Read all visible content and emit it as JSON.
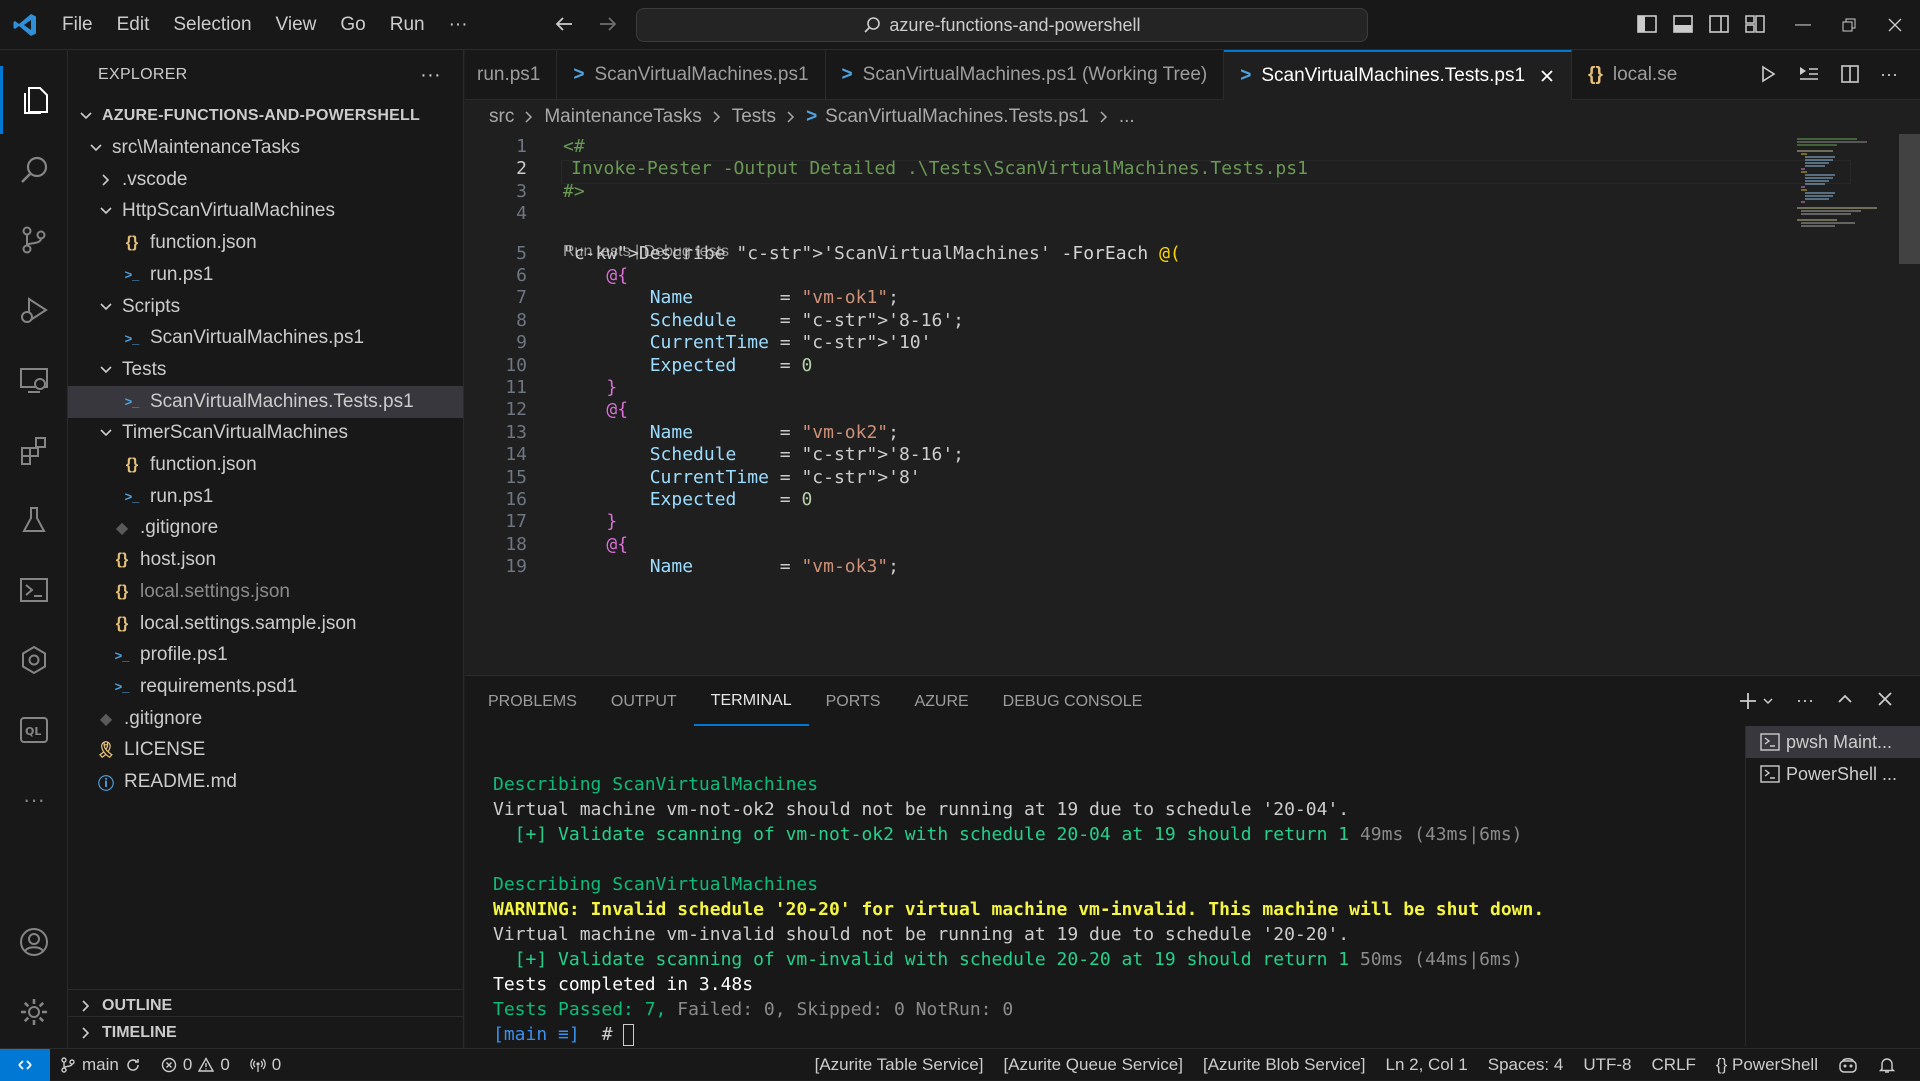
{
  "menu": [
    "File",
    "Edit",
    "Selection",
    "View",
    "Go",
    "Run",
    "···"
  ],
  "command_center": "azure-functions-and-powershell",
  "explorer": {
    "title": "EXPLORER",
    "more": "···",
    "root": "AZURE-FUNCTIONS-AND-POWERSHELL",
    "items": [
      {
        "label": "src\\MaintenanceTasks",
        "kind": "folder-open",
        "depth": 1
      },
      {
        "label": ".vscode",
        "kind": "folder-closed",
        "depth": 2
      },
      {
        "label": "HttpScanVirtualMachines",
        "kind": "folder-open",
        "depth": 2
      },
      {
        "label": "function.json",
        "kind": "json",
        "depth": 3
      },
      {
        "label": "run.ps1",
        "kind": "ps",
        "depth": 3
      },
      {
        "label": "Scripts",
        "kind": "folder-open",
        "depth": 2
      },
      {
        "label": "ScanVirtualMachines.ps1",
        "kind": "ps",
        "depth": 3
      },
      {
        "label": "Tests",
        "kind": "folder-open",
        "depth": 2
      },
      {
        "label": "ScanVirtualMachines.Tests.ps1",
        "kind": "ps",
        "depth": 3,
        "selected": true
      },
      {
        "label": "TimerScanVirtualMachines",
        "kind": "folder-open",
        "depth": 2
      },
      {
        "label": "function.json",
        "kind": "json",
        "depth": 3
      },
      {
        "label": "run.ps1",
        "kind": "ps",
        "depth": 3
      },
      {
        "label": ".gitignore",
        "kind": "git",
        "depth": 2
      },
      {
        "label": "host.json",
        "kind": "json",
        "depth": 2
      },
      {
        "label": "local.settings.json",
        "kind": "json",
        "depth": 2,
        "dim": true
      },
      {
        "label": "local.settings.sample.json",
        "kind": "json",
        "depth": 2
      },
      {
        "label": "profile.ps1",
        "kind": "ps",
        "depth": 2
      },
      {
        "label": "requirements.psd1",
        "kind": "ps",
        "depth": 2
      },
      {
        "label": ".gitignore",
        "kind": "git",
        "depth": 1
      },
      {
        "label": "LICENSE",
        "kind": "license",
        "depth": 1
      },
      {
        "label": "README.md",
        "kind": "info",
        "depth": 1
      }
    ],
    "outline": "OUTLINE",
    "timeline": "TIMELINE"
  },
  "tabs": [
    {
      "label": "run.ps1",
      "icon": "ps"
    },
    {
      "label": "ScanVirtualMachines.ps1",
      "icon": "ps"
    },
    {
      "label": "ScanVirtualMachines.ps1 (Working Tree)",
      "icon": "ps"
    },
    {
      "label": "ScanVirtualMachines.Tests.ps1",
      "icon": "ps",
      "active": true
    },
    {
      "label": "local.se",
      "icon": "json"
    }
  ],
  "breadcrumb": [
    "src",
    "MaintenanceTasks",
    "Tests",
    "ScanVirtualMachines.Tests.ps1",
    "..."
  ],
  "editor": {
    "codelens": "Run tests | Debug tests",
    "lines": [
      {
        "n": "1",
        "t": "<#"
      },
      {
        "n": "2",
        "t": "Invoke-Pester -Output Detailed .\\Tests\\ScanVirtualMachines.Tests.ps1"
      },
      {
        "n": "3",
        "t": "#>"
      },
      {
        "n": "4",
        "t": ""
      },
      {
        "n": "5",
        "t": "Describe 'ScanVirtualMachines' -ForEach @("
      },
      {
        "n": "6",
        "t": "    @{"
      },
      {
        "n": "7",
        "t": "        Name        = \"vm-ok1\";"
      },
      {
        "n": "8",
        "t": "        Schedule    = '8-16';"
      },
      {
        "n": "9",
        "t": "        CurrentTime = '10'"
      },
      {
        "n": "10",
        "t": "        Expected    = 0"
      },
      {
        "n": "11",
        "t": "    }"
      },
      {
        "n": "12",
        "t": "    @{"
      },
      {
        "n": "13",
        "t": "        Name        = \"vm-ok2\";"
      },
      {
        "n": "14",
        "t": "        Schedule    = '8-16';"
      },
      {
        "n": "15",
        "t": "        CurrentTime = '8'"
      },
      {
        "n": "16",
        "t": "        Expected    = 0"
      },
      {
        "n": "17",
        "t": "    }"
      },
      {
        "n": "18",
        "t": "    @{"
      },
      {
        "n": "19",
        "t": "        Name        = \"vm-ok3\";"
      }
    ]
  },
  "panel": {
    "tabs": [
      "PROBLEMS",
      "OUTPUT",
      "TERMINAL",
      "PORTS",
      "AZURE",
      "DEBUG CONSOLE"
    ],
    "active_tab": "TERMINAL",
    "terminal_lines": [
      {
        "style": "t-green2",
        "text": "Describing ScanVirtualMachines"
      },
      {
        "style": "",
        "text": "Virtual machine vm-not-ok2 should not be running at 19 due to schedule '20-04'."
      },
      {
        "style": "t-green",
        "text": "  [+] Validate scanning of vm-not-ok2 with schedule 20-04 at 19 should return 1 ",
        "suffix": "49ms (43ms|6ms)"
      },
      {
        "style": "",
        "text": ""
      },
      {
        "style": "t-green2",
        "text": "Describing ScanVirtualMachines"
      },
      {
        "style": "t-warn",
        "text": "WARNING: Invalid schedule '20-20' for virtual machine vm-invalid. This machine will be shut down."
      },
      {
        "style": "",
        "text": "Virtual machine vm-invalid should not be running at 19 due to schedule '20-20'."
      },
      {
        "style": "t-green",
        "text": "  [+] Validate scanning of vm-invalid with schedule 20-20 at 19 should return 1 ",
        "suffix": "50ms (44ms|6ms)"
      },
      {
        "style": "t-white",
        "text": "Tests completed in 3.48s"
      },
      {
        "style": "t-green2",
        "text": "Tests Passed: 7, ",
        "rest": "Failed: 0, Skipped: 0 NotRun: 0"
      }
    ],
    "prompt": {
      "branch": "[main ≡]",
      "symbol": "#"
    },
    "terminals": [
      {
        "label": "pwsh  Maint...",
        "selected": true
      },
      {
        "label": "PowerShell ..."
      }
    ]
  },
  "status": {
    "branch": "main",
    "errors": "0",
    "warnings": "0",
    "ports": "0",
    "right": [
      "[Azurite Table Service]",
      "[Azurite Queue Service]",
      "[Azurite Blob Service]",
      "Ln 2, Col 1",
      "Spaces: 4",
      "UTF-8",
      "CRLF",
      "{} PowerShell"
    ]
  }
}
